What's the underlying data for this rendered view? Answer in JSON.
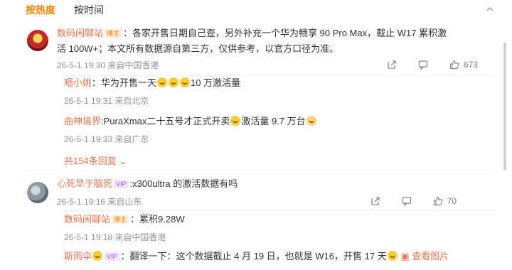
{
  "tabs": [
    {
      "label": "按热度"
    },
    {
      "label": "按时间"
    }
  ],
  "comments": [
    {
      "user": "数码闲聊站",
      "badge": "博主",
      "text": "：各家开售日期自己查，另外补充一个华为畅享 90 Pro Max，截止 W17 累积激活 100W+；本文所有数据源自第三方，仅供参考，以官方口径为准。",
      "text_line1": "：各家开售日期自己查，另外补充一个华为畅享 90 Pro Max，截止 W17 累积激",
      "text_line2": "活 100W+；本文所有数据源自第三方，仅供参考，以官方口径为准。",
      "time": "26-5-1 19:30",
      "location": "来自中国香港",
      "likes": "673",
      "replies": [
        {
          "user": "嗯小姚",
          "text_a": "：华为开售一天",
          "text_b": "10 万激活量",
          "time": "26-5-1 19:31",
          "location": "来自北京"
        },
        {
          "user": "曲神境界",
          "text_a": ":PuraXmax二十五号才正式开卖",
          "text_b": "激活量 9.7 万台",
          "time": "26-5-1 19:33",
          "location": "来自广东"
        }
      ],
      "more_replies": "共154条回复"
    },
    {
      "user": "心死早于脑死",
      "badge": "VIP",
      "text": ":x300ultra 的激活数据有吗",
      "time": "26-5-1 19:16",
      "location": "来自山东",
      "likes": "70",
      "replies": [
        {
          "user": "数码闲聊站",
          "badge": "博主",
          "text_a": "：累积9.28W",
          "time": "26-5-1 19:18",
          "location": "来自中国香港"
        },
        {
          "user": "斯雨伞",
          "badge": "VIP",
          "text_a": "：翻译一下：这个数据截止 4 月 19 日，也就是 W16，开售 17 天",
          "see_image": "查看图片"
        }
      ]
    }
  ],
  "colors": {
    "accent": "#ff8200",
    "username": "#eb7350",
    "meta": "#939393"
  },
  "icons": [
    "collapse-icon",
    "share-icon",
    "comment-icon",
    "like-icon",
    "emoji-icon"
  ]
}
